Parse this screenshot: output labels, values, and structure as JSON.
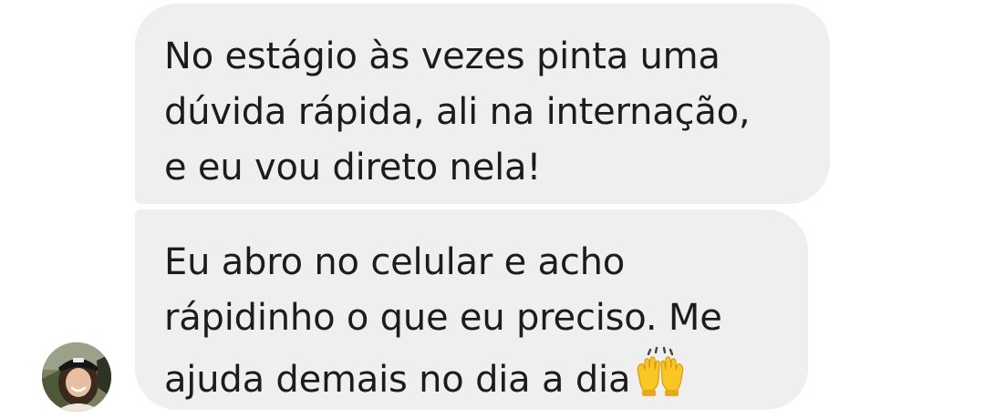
{
  "conversation": {
    "messages": [
      {
        "lines": [
          "No estágio às vezes pinta uma",
          "dúvida rápida, ali na internação,",
          "e eu vou direto nela!"
        ]
      },
      {
        "lines": [
          "Eu abro no celular e acho",
          "rápidinho o que eu preciso. Me",
          "ajuda demais no dia a dia"
        ],
        "trailing_emoji": "raising-hands-emoji"
      }
    ],
    "sender_avatar": "user-avatar-photo",
    "colors": {
      "bubble_bg": "#efefef",
      "text": "#1c1c1e",
      "emoji": "#f9c623"
    }
  }
}
